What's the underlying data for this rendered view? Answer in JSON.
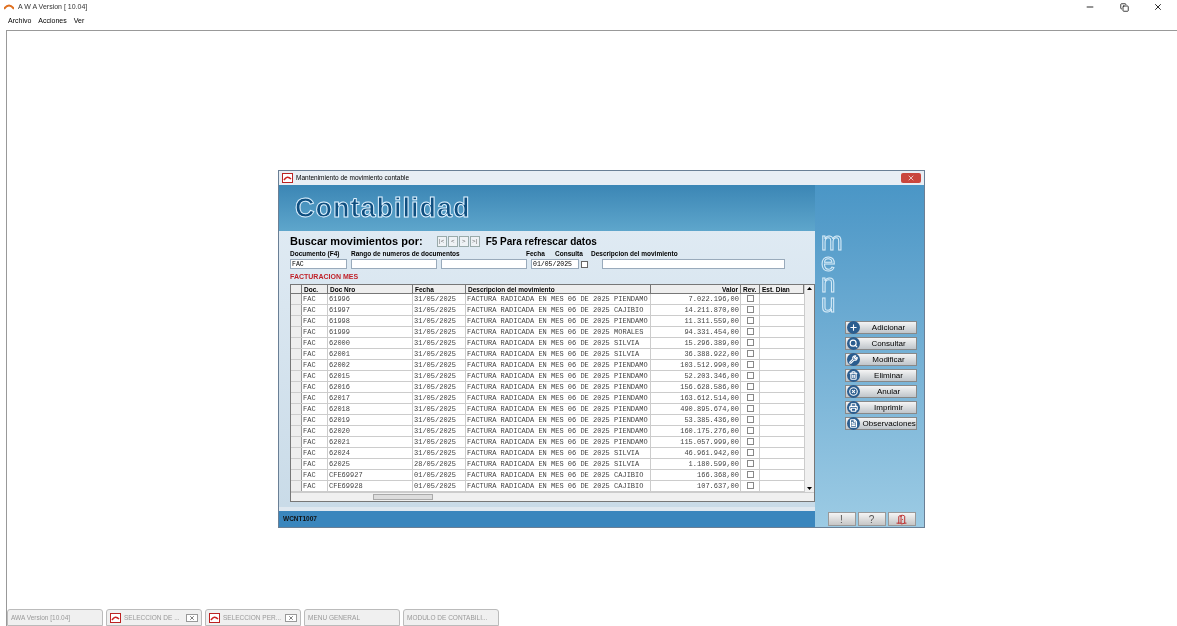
{
  "app": {
    "title": "A W A Version [ 10.04]",
    "menu": [
      "Archivo",
      "Acciones",
      "Ver"
    ]
  },
  "dialog": {
    "title": "Mantenimiento de movimiento contable",
    "banner": "Contabilidad",
    "side_label": "menu",
    "search": {
      "heading": "Buscar movimientos por:",
      "nav": [
        "|<",
        "<",
        ">",
        ">|"
      ],
      "refresh_hint": "F5 Para refrescar datos",
      "fields": [
        {
          "label": "Documento (F4)",
          "value": "FAC"
        },
        {
          "label": "Rango de numeros de documentos"
        },
        {
          "label": "Fecha",
          "value": "01/05/2025"
        }
      ],
      "consulta": {
        "label": "Consulta",
        "checked": false
      },
      "description_label": "Descripcion del movimiento"
    },
    "section_title": "FACTURACION MES",
    "table": {
      "columns": [
        "Doc.",
        "Doc Nro",
        "Fecha",
        "Descripcion del movimiento",
        "Valor",
        "Rev.",
        "Est. Dian"
      ],
      "rows": [
        {
          "doc": "FAC",
          "nro": "61996",
          "fecha": "31/05/2025",
          "desc": "FACTURA RADICADA EN MES 06 DE 2025 PIENDAMO",
          "valor": "7.022.196,00",
          "rev": false
        },
        {
          "doc": "FAC",
          "nro": "61997",
          "fecha": "31/05/2025",
          "desc": "FACTURA RADICADA EN MES 06 DE 2025 CAJIBIO",
          "valor": "14.211.870,00",
          "rev": false
        },
        {
          "doc": "FAC",
          "nro": "61998",
          "fecha": "31/05/2025",
          "desc": "FACTURA RADICADA EN MES 06 DE 2025 PIENDAMO",
          "valor": "11.311.559,00",
          "rev": false
        },
        {
          "doc": "FAC",
          "nro": "61999",
          "fecha": "31/05/2025",
          "desc": "FACTURA RADICADA EN MES 06 DE 2025 MORALES",
          "valor": "94.331.454,00",
          "rev": false
        },
        {
          "doc": "FAC",
          "nro": "62000",
          "fecha": "31/05/2025",
          "desc": "FACTURA RADICADA EN MES 06 DE 2025 SILVIA",
          "valor": "15.296.389,00",
          "rev": false
        },
        {
          "doc": "FAC",
          "nro": "62001",
          "fecha": "31/05/2025",
          "desc": "FACTURA RADICADA EN MES 06 DE 2025 SILVIA",
          "valor": "36.388.922,00",
          "rev": false
        },
        {
          "doc": "FAC",
          "nro": "62002",
          "fecha": "31/05/2025",
          "desc": "FACTURA RADICADA EN MES 06 DE 2025 PIENDAMO",
          "valor": "103.512.990,00",
          "rev": false
        },
        {
          "doc": "FAC",
          "nro": "62015",
          "fecha": "31/05/2025",
          "desc": "FACTURA RADICADA EN MES 06 DE 2025 PIENDAMO",
          "valor": "52.203.346,00",
          "rev": false
        },
        {
          "doc": "FAC",
          "nro": "62016",
          "fecha": "31/05/2025",
          "desc": "FACTURA RADICADA EN MES 06 DE 2025 PIENDAMO",
          "valor": "156.628.586,00",
          "rev": false
        },
        {
          "doc": "FAC",
          "nro": "62017",
          "fecha": "31/05/2025",
          "desc": "FACTURA RADICADA EN MES 06 DE 2025 PIENDAMO",
          "valor": "163.612.514,00",
          "rev": false
        },
        {
          "doc": "FAC",
          "nro": "62018",
          "fecha": "31/05/2025",
          "desc": "FACTURA RADICADA EN MES 06 DE 2025 PIENDAMO",
          "valor": "490.895.674,00",
          "rev": false
        },
        {
          "doc": "FAC",
          "nro": "62019",
          "fecha": "31/05/2025",
          "desc": "FACTURA RADICADA EN MES 06 DE 2025 PIENDAMO",
          "valor": "53.385.436,00",
          "rev": false
        },
        {
          "doc": "FAC",
          "nro": "62020",
          "fecha": "31/05/2025",
          "desc": "FACTURA RADICADA EN MES 06 DE 2025 PIENDAMO",
          "valor": "160.175.276,00",
          "rev": false
        },
        {
          "doc": "FAC",
          "nro": "62021",
          "fecha": "31/05/2025",
          "desc": "FACTURA RADICADA EN MES 06 DE 2025 PIENDAMO",
          "valor": "115.057.999,00",
          "rev": false
        },
        {
          "doc": "FAC",
          "nro": "62024",
          "fecha": "31/05/2025",
          "desc": "FACTURA RADICADA EN MES 06 DE 2025 SILVIA",
          "valor": "46.961.942,00",
          "rev": false
        },
        {
          "doc": "FAC",
          "nro": "62025",
          "fecha": "28/05/2025",
          "desc": "FACTURA RADICADA EN MES 06 DE 2025 SILVIA",
          "valor": "1.180.599,00",
          "rev": false
        },
        {
          "doc": "FAC",
          "nro": "CFE69927",
          "fecha": "01/05/2025",
          "desc": "FACTURA RADICADA EN MES 06 DE 2025 CAJIBIO",
          "valor": "166.368,00",
          "rev": false
        },
        {
          "doc": "FAC",
          "nro": "CFE69928",
          "fecha": "01/05/2025",
          "desc": "FACTURA RADICADA EN MES 06 DE 2025 CAJIBIO",
          "valor": "107.637,00",
          "rev": false
        }
      ]
    },
    "actions": [
      {
        "label": "Adicionar",
        "kind": "plus"
      },
      {
        "label": "Consultar",
        "kind": "query"
      },
      {
        "label": "Modificar",
        "kind": "tools"
      },
      {
        "label": "Eliminar",
        "kind": "trash"
      },
      {
        "label": "Anular",
        "kind": "cancel"
      },
      {
        "label": "Imprimir",
        "kind": "print"
      },
      {
        "label": "Observaciones",
        "kind": "notes"
      }
    ],
    "status_code": "WCNT1007",
    "status_buttons": [
      {
        "kind": "alert",
        "label": "!"
      },
      {
        "kind": "help",
        "label": "?"
      },
      {
        "kind": "exit"
      }
    ]
  },
  "taskbar": [
    {
      "label": "AWA Version [10.04]",
      "closable": false
    },
    {
      "label": "SELECCION DE ...",
      "closable": true
    },
    {
      "label": "SELECCION PER...",
      "closable": true
    },
    {
      "label": "MENU GENERAL",
      "closable": false
    },
    {
      "label": "MODULO DE CONTABILI...",
      "closable": false
    }
  ]
}
